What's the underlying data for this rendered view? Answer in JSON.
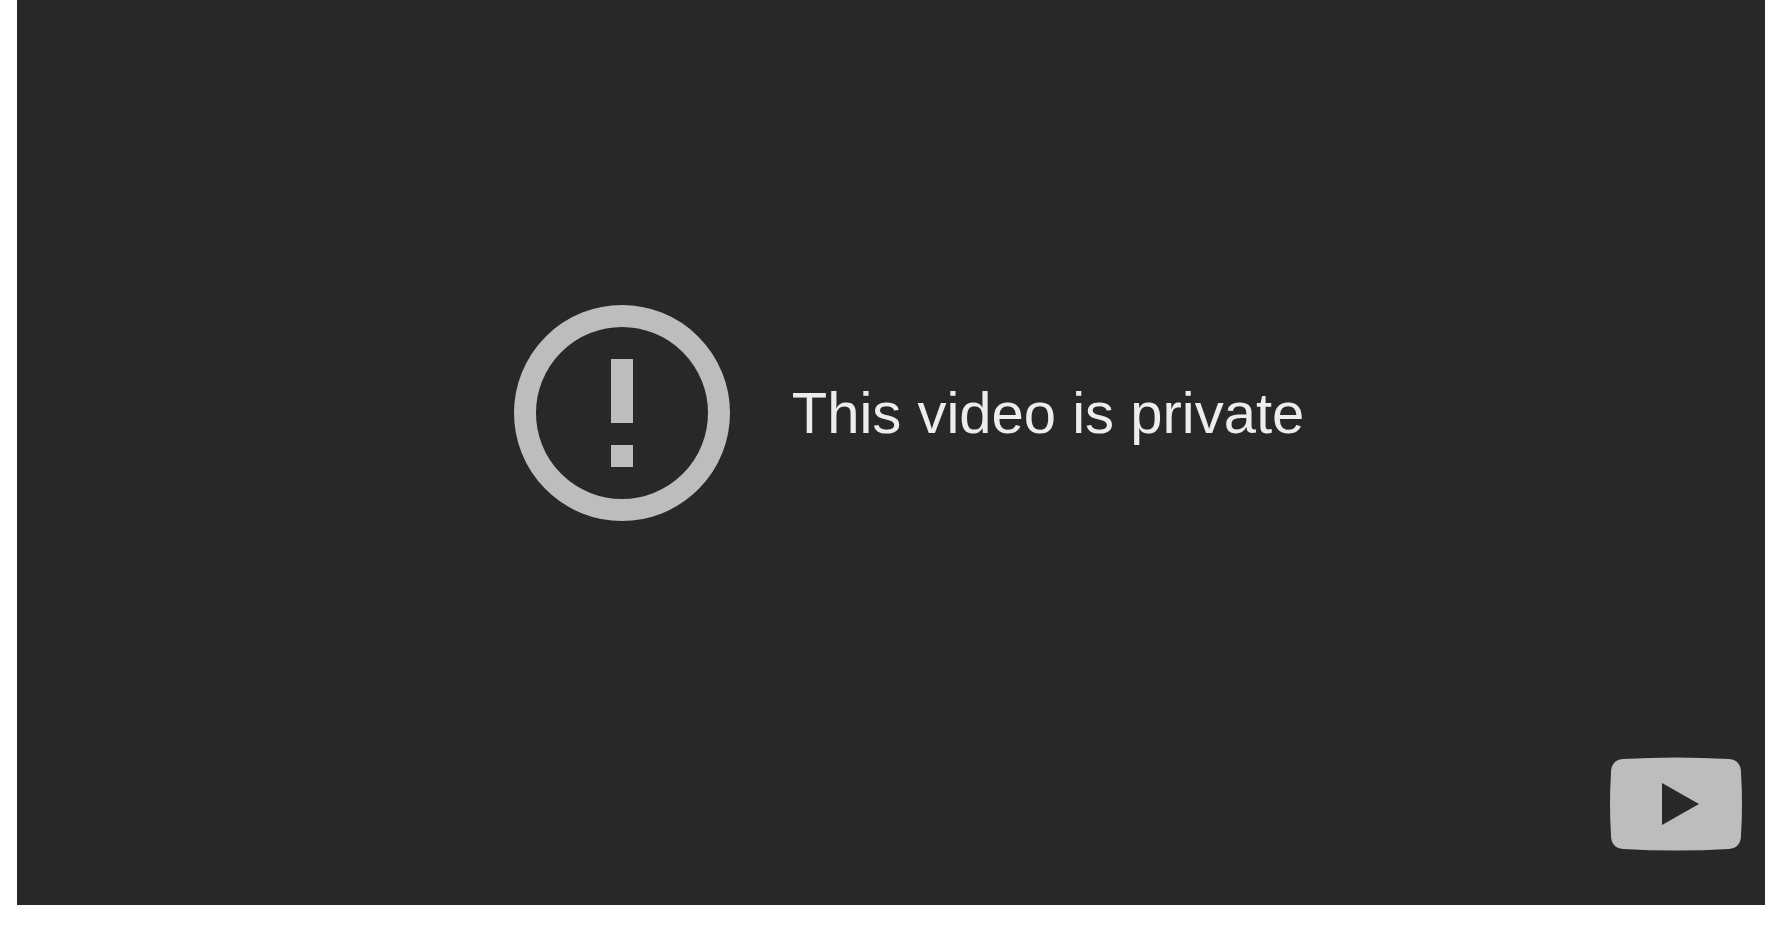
{
  "player": {
    "message": "This video is private"
  }
}
